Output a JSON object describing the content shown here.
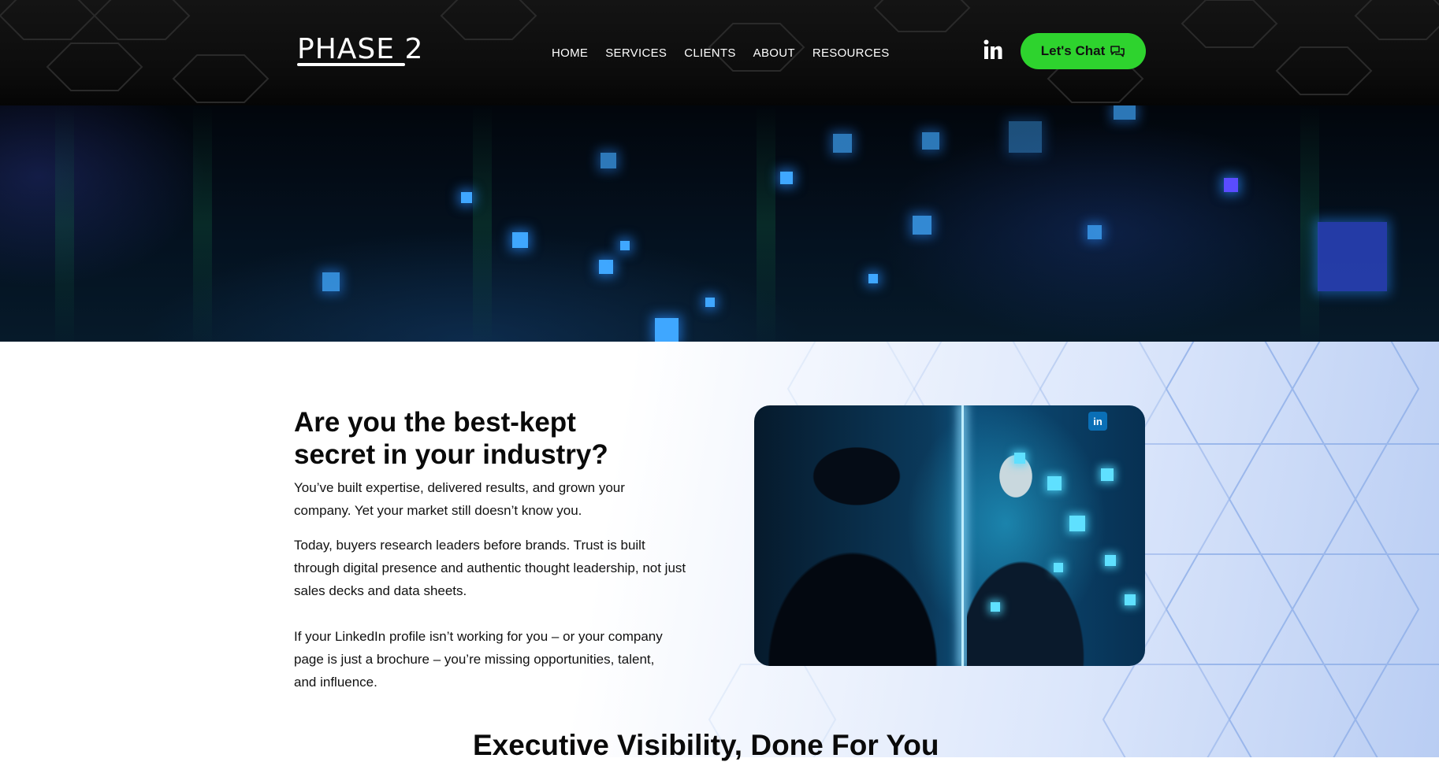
{
  "header": {
    "logo": "PHASE 2",
    "nav": [
      "HOME",
      "SERVICES",
      "CLIENTS",
      "ABOUT",
      "RESOURCES"
    ],
    "linkedin_icon": "linkedin-icon",
    "cta_label": "Let's Chat",
    "cta_icon": "chat-bubbles-icon",
    "cta_color": "#2ed32e"
  },
  "intro": {
    "headline": "Are you the best-kept secret in your industry?",
    "paragraphs": [
      "You’ve built expertise, delivered results, and grown your company. Yet your market still doesn’t know you.",
      "Today, buyers research leaders before brands. Trust is built through digital presence and authentic thought leadership, not just sales decks and data sheets.",
      "If your LinkedIn profile isn’t working for you – or your company page is just a brochure – you’re missing opportunities, talent, and influence."
    ]
  },
  "photo": {
    "badge": "in"
  },
  "section": {
    "title": "Executive Visibility, Done For You"
  }
}
